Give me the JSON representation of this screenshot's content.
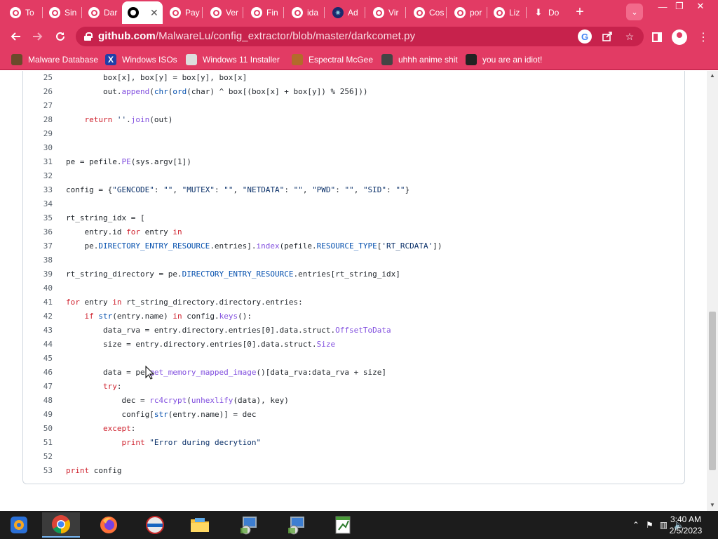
{
  "browser": {
    "tabs": [
      {
        "label": "To",
        "icon": "opera-icon"
      },
      {
        "label": "Sin",
        "icon": "opera-icon"
      },
      {
        "label": "Dar",
        "icon": "opera-icon"
      },
      {
        "label": "",
        "icon": "github-icon",
        "active": true
      },
      {
        "label": "Pay",
        "icon": "opera-icon"
      },
      {
        "label": "Ver",
        "icon": "opera-icon"
      },
      {
        "label": "Fin",
        "icon": "opera-icon"
      },
      {
        "label": "ida",
        "icon": "opera-icon"
      },
      {
        "label": "Ad",
        "icon": "virus-icon"
      },
      {
        "label": "Vir",
        "icon": "opera-icon"
      },
      {
        "label": "Cos",
        "icon": "opera-icon"
      },
      {
        "label": "por",
        "icon": "opera-icon"
      },
      {
        "label": "Liz",
        "icon": "opera-icon"
      },
      {
        "label": "Do",
        "icon": "download-icon"
      }
    ],
    "close_glyph": "✕",
    "new_tab_glyph": "+",
    "url_host": "github.com",
    "url_path": "/MalwareLu/config_extractor/blob/master/darkcomet.py",
    "window_controls": {
      "minimize": "—",
      "restore": "❐",
      "close": "✕"
    },
    "bookmarks": [
      {
        "label": "Malware Database",
        "icon": "malware-db-icon",
        "color": "#6b4a2b"
      },
      {
        "label": "Windows ISOs",
        "icon": "x-icon",
        "color": "#1f3fa8"
      },
      {
        "label": "Windows 11 Installer",
        "icon": "installer-icon",
        "color": "#ddd"
      },
      {
        "label": "Espectral McGee",
        "icon": "character-icon",
        "color": "#b36b2b"
      },
      {
        "label": "uhhh anime shit",
        "icon": "anime-icon",
        "color": "#444"
      },
      {
        "label": "you are an idiot!",
        "icon": "idiot-icon",
        "color": "#222"
      }
    ]
  },
  "code": {
    "lines": [
      {
        "n": "25",
        "html": "        box[x], box[y] = box[y], box[x]"
      },
      {
        "n": "26",
        "html": "        out.<span class=\"fn\">append</span>(<span class=\"bi\">chr</span>(<span class=\"bi\">ord</span>(char) ^ box[(box[x] + box[y]) % 256]))"
      },
      {
        "n": "27",
        "html": ""
      },
      {
        "n": "28",
        "html": "    <span class=\"kw\">return</span> <span class=\"str\">''</span>.<span class=\"fn\">join</span>(out)"
      },
      {
        "n": "29",
        "html": ""
      },
      {
        "n": "30",
        "html": ""
      },
      {
        "n": "31",
        "html": "pe = pefile.<span class=\"fn\">PE</span>(sys.argv[1])"
      },
      {
        "n": "32",
        "html": ""
      },
      {
        "n": "33",
        "html": "config = {<span class=\"str\">\"GENCODE\"</span>: <span class=\"str\">\"\"</span>, <span class=\"str\">\"MUTEX\"</span>: <span class=\"str\">\"\"</span>, <span class=\"str\">\"NETDATA\"</span>: <span class=\"str\">\"\"</span>, <span class=\"str\">\"PWD\"</span>: <span class=\"str\">\"\"</span>, <span class=\"str\">\"SID\"</span>: <span class=\"str\">\"\"</span>}"
      },
      {
        "n": "34",
        "html": ""
      },
      {
        "n": "35",
        "html": "rt_string_idx = ["
      },
      {
        "n": "36",
        "html": "    entry.id <span class=\"kw\">for</span> entry <span class=\"kw\">in</span>"
      },
      {
        "n": "37",
        "html": "    pe.<span class=\"bi\">DIRECTORY_ENTRY_RESOURCE</span>.entries].<span class=\"fn\">index</span>(pefile.<span class=\"bi\">RESOURCE_TYPE</span>[<span class=\"str\">'RT_RCDATA'</span>])"
      },
      {
        "n": "38",
        "html": ""
      },
      {
        "n": "39",
        "html": "rt_string_directory = pe.<span class=\"bi\">DIRECTORY_ENTRY_RESOURCE</span>.entries[rt_string_idx]"
      },
      {
        "n": "40",
        "html": ""
      },
      {
        "n": "41",
        "html": "<span class=\"kw\">for</span> entry <span class=\"kw\">in</span> rt_string_directory.directory.entries:"
      },
      {
        "n": "42",
        "html": "    <span class=\"kw\">if</span> <span class=\"bi\">str</span>(entry.name) <span class=\"kw\">in</span> config.<span class=\"fn\">keys</span>():"
      },
      {
        "n": "43",
        "html": "        data_rva = entry.directory.entries[0].data.struct.<span class=\"fn\">OffsetToData</span>"
      },
      {
        "n": "44",
        "html": "        size = entry.directory.entries[0].data.struct.<span class=\"fn\">Size</span>"
      },
      {
        "n": "45",
        "html": ""
      },
      {
        "n": "46",
        "html": "        data = pe.<span class=\"fn\">get_memory_mapped_image</span>()[data_rva:data_rva + size]"
      },
      {
        "n": "47",
        "html": "        <span class=\"kw\">try</span>:"
      },
      {
        "n": "48",
        "html": "            dec = <span class=\"fn\">rc4crypt</span>(<span class=\"fn\">unhexlify</span>(data), key)"
      },
      {
        "n": "49",
        "html": "            config[<span class=\"bi\">str</span>(entry.name)] = dec"
      },
      {
        "n": "50",
        "html": "        <span class=\"kw\">except</span>:"
      },
      {
        "n": "51",
        "html": "            <span class=\"kw\">print</span> <span class=\"str\">\"Error during decrytion\"</span>"
      },
      {
        "n": "52",
        "html": ""
      },
      {
        "n": "53",
        "html": "<span class=\"kw\">print</span> config"
      }
    ]
  },
  "taskbar": {
    "apps": [
      {
        "name": "start-icon"
      },
      {
        "name": "chrome-icon",
        "active": true
      },
      {
        "name": "firefox-icon"
      },
      {
        "name": "windows-update-icon"
      },
      {
        "name": "file-explorer-icon"
      },
      {
        "name": "installer-app-icon"
      },
      {
        "name": "installer-app-icon-2"
      },
      {
        "name": "notepad-app-icon"
      }
    ],
    "time": "3:40 AM",
    "date": "2/5/2023"
  }
}
